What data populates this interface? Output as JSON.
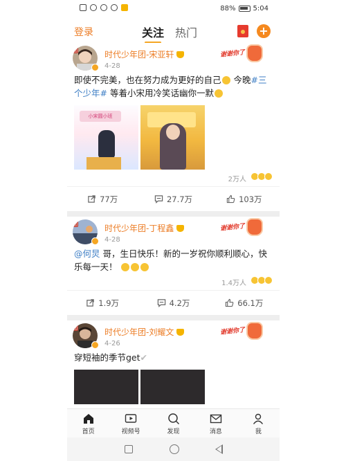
{
  "status_bar": {
    "battery": "88%",
    "time": "5:04"
  },
  "header": {
    "login_label": "登录",
    "tabs": [
      "关注",
      "热门"
    ],
    "active_tab": "关注",
    "plus_label": "+"
  },
  "colors": {
    "accent": "#ec7d26",
    "link": "#3d7ec5",
    "badge": "#f5a623"
  },
  "posts": [
    {
      "author": "时代少年团-宋亚轩",
      "date": "4-28",
      "sticker": "谢谢你了",
      "text_parts": [
        "即使不完美，也在努力成为更好的自己",
        "今晚",
        "#三个少年#",
        "等着小宋用冷笑话幽你一默"
      ],
      "image_caption": "小宋圆小班",
      "likes_summary": "2万人",
      "repost": "77万",
      "comment": "27.7万",
      "like": "103万"
    },
    {
      "author": "时代少年团-丁程鑫",
      "date": "4-28",
      "sticker": "谢谢你了",
      "text_parts": [
        "@何炅",
        " 哥，生日快乐！新的一岁祝你顺利顺心，快乐每一天！"
      ],
      "likes_summary": "1.4万人",
      "repost": "1.9万",
      "comment": "4.2万",
      "like": "66.1万"
    },
    {
      "author": "时代少年团-刘耀文",
      "date": "4-26",
      "sticker": "谢谢你了",
      "text_parts": [
        "穿短袖的季节get"
      ]
    }
  ],
  "bottom_nav": [
    "首页",
    "视频号",
    "发现",
    "消息",
    "我"
  ]
}
